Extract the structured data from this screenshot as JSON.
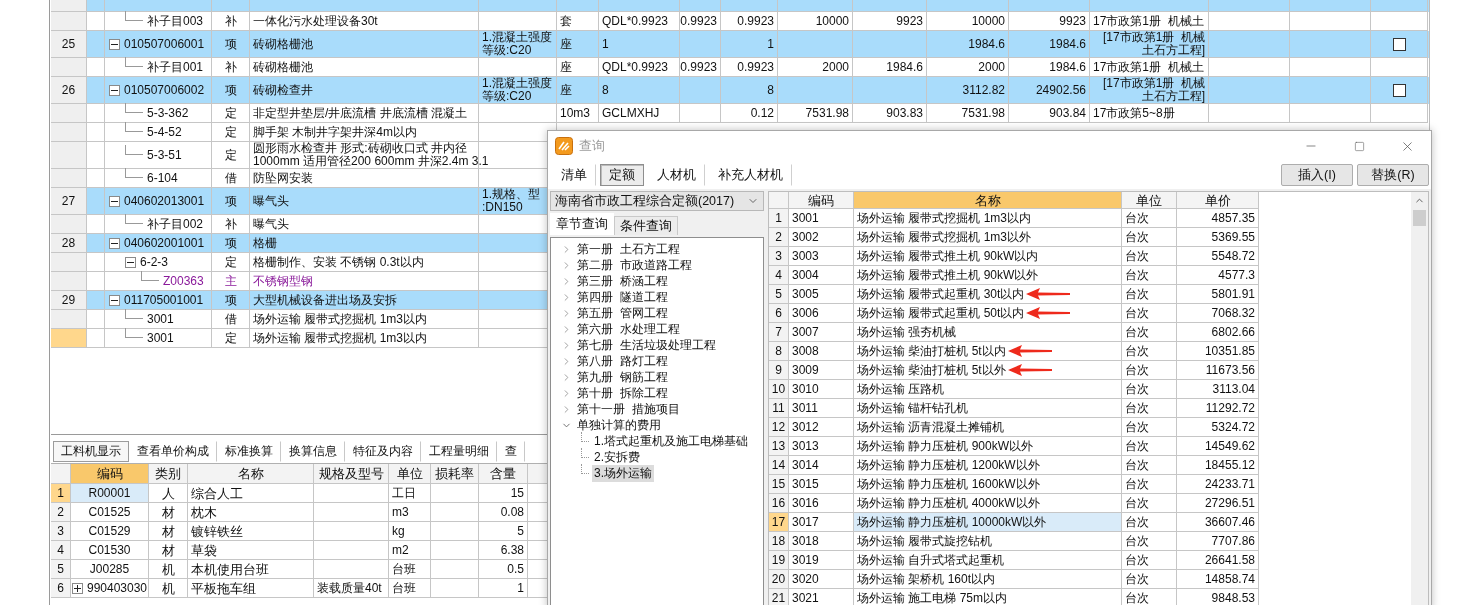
{
  "main_grid": {
    "rows": [
      {
        "kind": "item",
        "selected": false,
        "children": [
          {
            "kind": "sub",
            "selected": false,
            "code": "补子目003",
            "type": "补",
            "name": "一体化污水处理设备30t",
            "unit": "套",
            "column_8": "QDL*0.9923",
            "column_9": "0.9923",
            "column_10": "0.9923",
            "column_11": "10000",
            "column_12": "9923",
            "column_13": "10000",
            "column_14": "9923",
            "column_15": "17市政第1册  机械土"
          }
        ]
      },
      {
        "kind": "item",
        "selected": false,
        "number": "25",
        "expanded": true,
        "code": "010507006001",
        "type": "项",
        "name": "砖砌格栅池",
        "spec": "1.混凝土强度等级:C20",
        "unit": "座",
        "column_8": "1",
        "column_10": "1",
        "column_13": "1984.6",
        "column_14": "1984.6",
        "column_15": "[17市政第1册  机械土石方工程]",
        "checked": false,
        "children": [
          {
            "kind": "sub",
            "selected": false,
            "code": "补子目001",
            "type": "补",
            "name": "砖砌格栅池",
            "unit": "座",
            "column_8": "QDL*0.9923",
            "column_9": "0.9923",
            "column_10": "0.9923",
            "column_11": "2000",
            "column_12": "1984.6",
            "column_13": "2000",
            "column_14": "1984.6",
            "column_15": "17市政第1册  机械土"
          }
        ]
      },
      {
        "kind": "item",
        "selected": false,
        "number": "26",
        "expanded": true,
        "code": "010507006002",
        "type": "项",
        "name": "砖砌检查井",
        "spec": "1.混凝土强度等级:C20",
        "unit": "座",
        "column_8": "8",
        "column_10": "8",
        "column_13": "3112.82",
        "column_14": "24902.56",
        "column_15": "[17市政第1册  机械土石方工程]",
        "checked": false,
        "children": [
          {
            "kind": "sub",
            "selected": false,
            "code": "5-3-362",
            "type": "定",
            "name": "非定型井垫层/井底流槽 井底流槽 混凝土",
            "unit": "10m3",
            "column_8": "GCLMXHJ",
            "column_10": "0.12",
            "column_11": "7531.98",
            "column_12": "903.83",
            "column_13": "7531.98",
            "column_14": "903.84",
            "column_15": "17市政第5~8册"
          },
          {
            "kind": "sub",
            "selected": false,
            "code": "5-4-52",
            "type": "定",
            "name": "脚手架 木制井字架井深4m以内"
          },
          {
            "kind": "sub",
            "selected": false,
            "code": "5-3-51",
            "type": "定",
            "name": "圆形雨水检查井 形式:砖砌收口式 井内径\n1000mm 适用管径200 600mm 井深2.4m 3.1"
          },
          {
            "kind": "sub",
            "selected": false,
            "code": "6-104",
            "type": "借",
            "name": "防坠网安装"
          }
        ]
      },
      {
        "kind": "item",
        "selected": false,
        "number": "27",
        "expanded": true,
        "code": "040602013001",
        "type": "项",
        "name": "曝气头",
        "spec": "1.规格、型\n:DN150",
        "children": [
          {
            "kind": "sub",
            "selected": false,
            "code": "补子目002",
            "type": "补",
            "name": "曝气头"
          }
        ]
      },
      {
        "kind": "item",
        "selected": false,
        "number": "28",
        "expanded": true,
        "code": "040602001001",
        "type": "项",
        "name": "格栅",
        "children": [
          {
            "kind": "sub",
            "selected": false,
            "expanded": true,
            "code": "6-2-3",
            "type": "定",
            "name": "格栅制作、安装 不锈钢 0.3t以内",
            "children": [
              {
                "kind": "material",
                "selected": false,
                "code": "Z00363",
                "type": "主",
                "name": "不锈钢型钢"
              }
            ]
          }
        ]
      },
      {
        "kind": "item",
        "selected": false,
        "number": "29",
        "expanded": true,
        "code": "011705001001",
        "type": "项",
        "name": "大型机械设备进出场及安拆",
        "children": [
          {
            "kind": "sub",
            "selected": false,
            "code": "3001",
            "type": "借",
            "name": "场外运输 履带式挖掘机 1m3以内"
          },
          {
            "kind": "sub",
            "selected": true,
            "code": "3001",
            "type": "定",
            "name": "场外运输 履带式挖掘机 1m3以内"
          }
        ]
      }
    ]
  },
  "bottom_panel": {
    "tabs": [
      {
        "label": "工料机显示",
        "selected": true
      },
      {
        "label": "查看单价构成",
        "selected": false
      },
      {
        "label": "标准换算",
        "selected": false
      },
      {
        "label": "换算信息",
        "selected": false
      },
      {
        "label": "特征及内容",
        "selected": false
      },
      {
        "label": "工程量明细",
        "selected": false
      },
      {
        "label": "查",
        "selected": false
      }
    ],
    "table": {
      "columns": [
        "编码",
        "类别",
        "名称",
        "规格及型号",
        "单位",
        "损耗率",
        "含量"
      ],
      "rows": [
        {
          "number": "1",
          "code": "R00001",
          "type": "人",
          "name": "综合人工",
          "unit": "工日",
          "quantity": "15",
          "selected": true
        },
        {
          "number": "2",
          "code": "C01525",
          "type": "材",
          "name": "枕木",
          "unit": "m3",
          "quantity": "0.08",
          "selected": false
        },
        {
          "number": "3",
          "code": "C01529",
          "type": "材",
          "name": "镀锌铁丝",
          "unit": "kg",
          "quantity": "5",
          "selected": false
        },
        {
          "number": "4",
          "code": "C01530",
          "type": "材",
          "name": "草袋",
          "unit": "m2",
          "quantity": "6.38",
          "selected": false
        },
        {
          "number": "5",
          "code": "J00285",
          "type": "机",
          "name": "本机使用台班",
          "unit": "台班",
          "quantity": "0.5",
          "selected": false
        },
        {
          "number": "6",
          "code": "990403030",
          "type": "机",
          "name": "平板拖车组",
          "spec": "装载质量40t",
          "unit": "台班",
          "quantity": "1",
          "selected": false,
          "expanded": false
        }
      ]
    }
  },
  "dialog": {
    "title": "查询",
    "tabs": [
      {
        "label": "清单",
        "selected": false
      },
      {
        "label": "定额",
        "selected": true
      },
      {
        "label": "人材机",
        "selected": false
      },
      {
        "label": "补充人材机",
        "selected": false
      }
    ],
    "buttons": [
      "插入(I)",
      "替换(R)"
    ],
    "library": "海南省市政工程综合定额(2017)",
    "query_tabs": [
      {
        "label": "章节查询",
        "selected": true
      },
      {
        "label": "条件查询",
        "selected": false
      }
    ],
    "chapters": [
      {
        "label": "第一册  土石方工程",
        "expanded": false,
        "selected": false
      },
      {
        "label": "第二册  市政道路工程",
        "expanded": false,
        "selected": false
      },
      {
        "label": "第三册  桥涵工程",
        "expanded": false,
        "selected": false
      },
      {
        "label": "第四册  隧道工程",
        "expanded": false,
        "selected": false
      },
      {
        "label": "第五册  管网工程",
        "expanded": false,
        "selected": false
      },
      {
        "label": "第六册  水处理工程",
        "expanded": false,
        "selected": false
      },
      {
        "label": "第七册  生活垃圾处理工程",
        "expanded": false,
        "selected": false
      },
      {
        "label": "第八册  路灯工程",
        "expanded": false,
        "selected": false
      },
      {
        "label": "第九册  钢筋工程",
        "expanded": false,
        "selected": false
      },
      {
        "label": "第十册  拆除工程",
        "expanded": false,
        "selected": false
      },
      {
        "label": "第十一册  措施项目",
        "expanded": false,
        "selected": false
      },
      {
        "label": "单独计算的费用",
        "expanded": true,
        "selected": false,
        "children": [
          {
            "label": "1.塔式起重机及施工电梯基础",
            "selected": false
          },
          {
            "label": "2.安拆费",
            "selected": false
          },
          {
            "label": "3.场外运输",
            "selected": true
          }
        ]
      }
    ],
    "table": {
      "columns": [
        "编码",
        "名称",
        "单位",
        "单价"
      ],
      "rows": [
        {
          "number": "1",
          "code": "3001",
          "name": "场外运输 履带式挖掘机 1m3以内",
          "unit": "台次",
          "price": "4857.35",
          "selected": false,
          "annotated": false
        },
        {
          "number": "2",
          "code": "3002",
          "name": "场外运输 履带式挖掘机 1m3以外",
          "unit": "台次",
          "price": "5369.55",
          "selected": false,
          "annotated": false
        },
        {
          "number": "3",
          "code": "3003",
          "name": "场外运输 履带式推土机 90kW以内",
          "unit": "台次",
          "price": "5548.72",
          "selected": false,
          "annotated": false
        },
        {
          "number": "4",
          "code": "3004",
          "name": "场外运输 履带式推土机 90kW以外",
          "unit": "台次",
          "price": "4577.3",
          "selected": false,
          "annotated": false
        },
        {
          "number": "5",
          "code": "3005",
          "name": "场外运输 履带式起重机 30t以内",
          "unit": "台次",
          "price": "5801.91",
          "selected": false,
          "annotated": true
        },
        {
          "number": "6",
          "code": "3006",
          "name": "场外运输 履带式起重机 50t以内",
          "unit": "台次",
          "price": "7068.32",
          "selected": false,
          "annotated": true
        },
        {
          "number": "7",
          "code": "3007",
          "name": "场外运输 强夯机械",
          "unit": "台次",
          "price": "6802.66",
          "selected": false,
          "annotated": false
        },
        {
          "number": "8",
          "code": "3008",
          "name": "场外运输 柴油打桩机 5t以内",
          "unit": "台次",
          "price": "10351.85",
          "selected": false,
          "annotated": true
        },
        {
          "number": "9",
          "code": "3009",
          "name": "场外运输 柴油打桩机 5t以外",
          "unit": "台次",
          "price": "11673.56",
          "selected": false,
          "annotated": true
        },
        {
          "number": "10",
          "code": "3010",
          "name": "场外运输 压路机",
          "unit": "台次",
          "price": "3113.04",
          "selected": false,
          "annotated": false
        },
        {
          "number": "11",
          "code": "3011",
          "name": "场外运输 锚杆钻孔机",
          "unit": "台次",
          "price": "11292.72",
          "selected": false,
          "annotated": false
        },
        {
          "number": "12",
          "code": "3012",
          "name": "场外运输 沥青混凝土摊铺机",
          "unit": "台次",
          "price": "5324.72",
          "selected": false,
          "annotated": false
        },
        {
          "number": "13",
          "code": "3013",
          "name": "场外运输 静力压桩机 900kW以外",
          "unit": "台次",
          "price": "14549.62",
          "selected": false,
          "annotated": false
        },
        {
          "number": "14",
          "code": "3014",
          "name": "场外运输 静力压桩机 1200kW以外",
          "unit": "台次",
          "price": "18455.12",
          "selected": false,
          "annotated": false
        },
        {
          "number": "15",
          "code": "3015",
          "name": "场外运输 静力压桩机 1600kW以外",
          "unit": "台次",
          "price": "24233.71",
          "selected": false,
          "annotated": false
        },
        {
          "number": "16",
          "code": "3016",
          "name": "场外运输 静力压桩机 4000kW以外",
          "unit": "台次",
          "price": "27296.51",
          "selected": false,
          "annotated": false
        },
        {
          "number": "17",
          "code": "3017",
          "name": "场外运输 静力压桩机 10000kW以外",
          "unit": "台次",
          "price": "36607.46",
          "selected": true,
          "annotated": false
        },
        {
          "number": "18",
          "code": "3018",
          "name": "场外运输 履带式旋挖钻机",
          "unit": "台次",
          "price": "7707.86",
          "selected": false,
          "annotated": false
        },
        {
          "number": "19",
          "code": "3019",
          "name": "场外运输 自升式塔式起重机",
          "unit": "台次",
          "price": "26641.58",
          "selected": false,
          "annotated": false
        },
        {
          "number": "20",
          "code": "3020",
          "name": "场外运输 架桥机 160t以内",
          "unit": "台次",
          "price": "14858.74",
          "selected": false,
          "annotated": false
        },
        {
          "number": "21",
          "code": "3021",
          "name": "场外运输 施工电梯 75m以内",
          "unit": "台次",
          "price": "9848.53",
          "selected": false,
          "annotated": false
        }
      ]
    }
  }
}
